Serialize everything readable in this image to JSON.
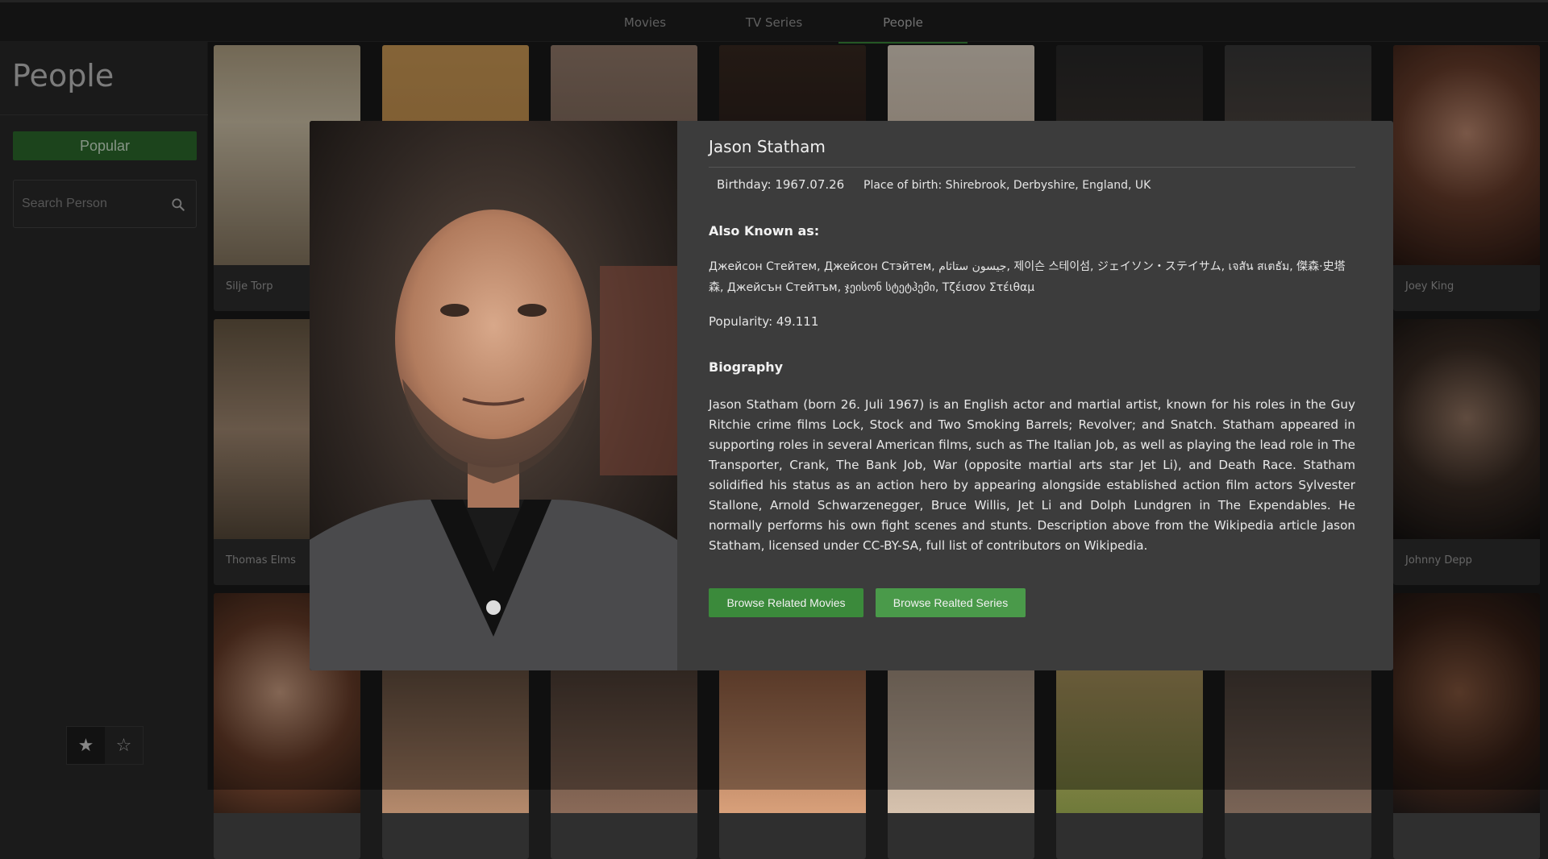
{
  "nav": {
    "tabs": [
      {
        "label": "Movies"
      },
      {
        "label": "TV Series"
      },
      {
        "label": "People"
      }
    ]
  },
  "sidebar": {
    "title": "People",
    "popular_label": "Popular",
    "search_placeholder": "Search Person",
    "icons": {
      "search": "search-icon",
      "star_filled": "star-icon",
      "star_outline": "star-outline-icon"
    }
  },
  "grid": {
    "visible_names": [
      "Silje Torp",
      "Joey King",
      "Thomas Elms",
      "Johnny Depp"
    ]
  },
  "modal": {
    "name": "Jason Statham",
    "birthday": "Birthday: 1967.07.26",
    "place_of_birth": "Place of birth: Shirebrook, Derbyshire, England, UK",
    "aka_heading": "Also Known as:",
    "aka_text": "Джейсон Стейтем, Джейсон Стэйтем, جيسون ستاثام, 제이슨 스테이섬, ジェイソン・ステイサム, เจสัน สเตธัม, 傑森·史塔森, Джейсън Стейтъм, ჯეისონ სტეტჰემი, Τζέισον Στέιθαμ",
    "popularity": "Popularity: 49.111",
    "bio_heading": "Biography",
    "bio": "Jason Statham (born 26. Juli 1967) is an English actor and martial artist, known for his roles in the Guy Ritchie crime films Lock, Stock and Two Smoking Barrels; Revolver; and Snatch. Statham appeared in supporting roles in several American films, such as The Italian Job, as well as playing the lead role in The Transporter, Crank, The Bank Job, War (opposite martial arts star Jet Li), and Death Race. Statham solidified his status as an action hero by appearing alongside established action film actors Sylvester Stallone, Arnold Schwarzenegger, Bruce Willis, Jet Li and Dolph Lundgren in The Expendables. He normally performs his own fight scenes and stunts. Description above from the Wikipedia article Jason Statham, licensed under CC-BY-SA, full list of contributors on Wikipedia.",
    "btn_movies": "Browse Related Movies",
    "btn_series": "Browse Realted Series"
  },
  "colors": {
    "accent": "#3b8a3b",
    "bg": "#1b1b1b",
    "panel": "#3c3c3c"
  }
}
